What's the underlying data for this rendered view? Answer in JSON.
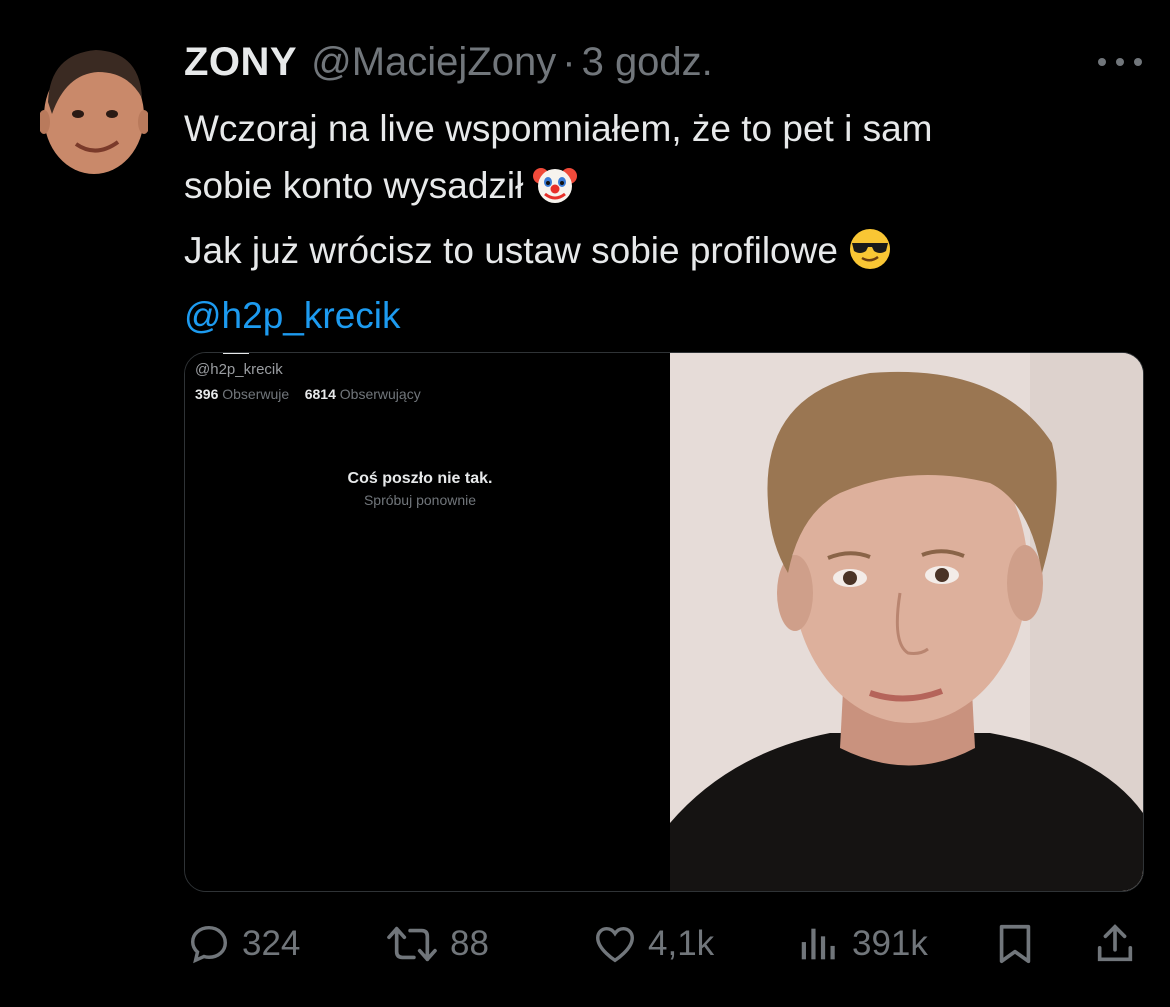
{
  "author": {
    "name": "ZONY",
    "handle": "@MaciejZony",
    "separator": "·",
    "time": "3 godz."
  },
  "tweet": {
    "line1": "Wczoraj na live wspomniałem, że to pet i sam",
    "line2": "sobie konto wysadził",
    "line3": "Jak już wrócisz to ustaw sobie profilowe",
    "mention": "@h2p_krecik",
    "emoji1": "clown-face-emoji",
    "emoji2": "sunglasses-face-emoji"
  },
  "media": {
    "screenshot": {
      "handle": "@h2p_krecik",
      "following_count": "396",
      "following_label": "Obserwuje",
      "followers_count": "6814",
      "followers_label": "Obserwujący",
      "error_title": "Coś poszło nie tak.",
      "error_retry": "Spróbuj ponownie"
    },
    "photo": "selfie-photo"
  },
  "actions": {
    "replies": "324",
    "reposts": "88",
    "likes": "4,1k",
    "views": "391k"
  },
  "colors": {
    "background": "#000000",
    "text": "#e7e9ea",
    "secondary": "#71767b",
    "accent": "#1d9bf0"
  }
}
